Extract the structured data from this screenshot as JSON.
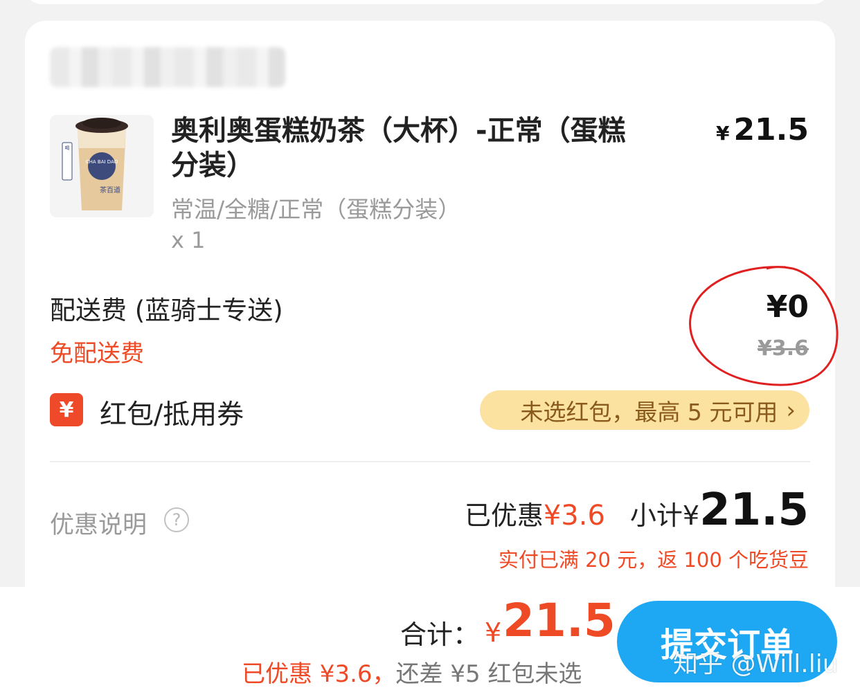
{
  "item": {
    "title": "奥利奥蛋糕奶茶（大杯）-正常（蛋糕分装）",
    "price_currency": "¥",
    "price": "21.5",
    "spec": "常温/全糖/正常（蛋糕分装）",
    "qty": "x 1",
    "cup_brand": "茶百道",
    "cup_text": "CHA BAI DAO",
    "cup_side": "喝前摇匀 风味更佳"
  },
  "delivery": {
    "label": "配送费 (蓝骑士专送)",
    "free_text": "免配送费",
    "price": "¥0",
    "original_price": "¥3.6"
  },
  "coupon": {
    "icon": "¥",
    "label": "红包/抵用券",
    "pill_text": "未选红包，最高 5 元可用",
    "pill_chevron": "›"
  },
  "summary": {
    "promo_label": "优惠说明",
    "help_icon": "?",
    "discount_label": "已优惠",
    "discount_value": "¥3.6",
    "subtotal_label": "小计",
    "subtotal_cur": "¥",
    "subtotal_value": "21.5",
    "cashback": "实付已满 20 元，返 100 个吃货豆"
  },
  "footer": {
    "total_label": "合计：",
    "total_cur": "¥",
    "total_value": "21.5",
    "total_discount": "已优惠 ¥3.6，",
    "total_remaining": "还差 ¥5 红包未选",
    "submit_label": "提交订单",
    "watermark": "知乎 @Will.liu"
  },
  "colors": {
    "accent": "#ef4a26",
    "button": "#1ea8f3",
    "pill_bg": "#fbe2a0",
    "pill_text": "#8a5a1c"
  }
}
